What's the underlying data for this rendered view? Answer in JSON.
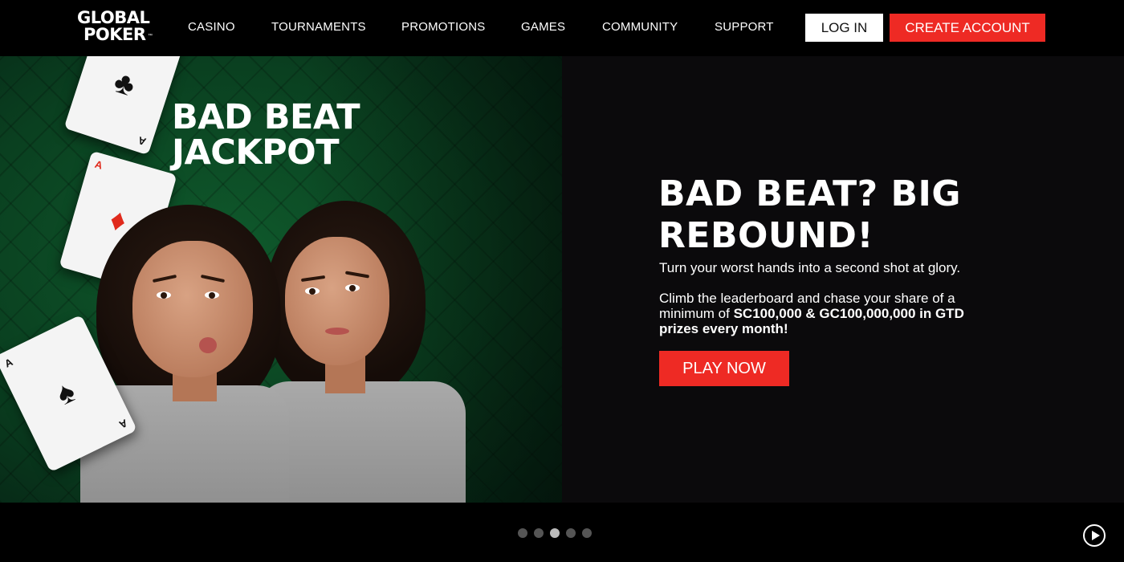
{
  "brand": {
    "logo_line1": "GLOBAL",
    "logo_line2": "POKER",
    "logo_mark": "™"
  },
  "nav": {
    "items": [
      "CASINO",
      "TOURNAMENTS",
      "PROMOTIONS",
      "GAMES",
      "COMMUNITY",
      "SUPPORT"
    ]
  },
  "auth": {
    "login_label": "LOG IN",
    "create_label": "CREATE ACCOUNT"
  },
  "hero": {
    "banner_title_line1": "BAD BEAT",
    "banner_title_line2": "JACKPOT",
    "headline_line1": "BAD BEAT? BIG",
    "headline_line2": "REBOUND!",
    "subheading": "Turn your worst hands into a second shot at glory.",
    "body_prefix": "Climb the leaderboard  and chase your share of a minimum of ",
    "body_bold": "SC100,000 & GC100,000,000 in GTD prizes every month!",
    "cta_label": "PLAY NOW",
    "cards": [
      {
        "suit": "♣",
        "rank": "A",
        "color": "black"
      },
      {
        "suit": "♦",
        "rank": "A",
        "color": "red"
      },
      {
        "suit": "♠",
        "rank": "A",
        "color": "black"
      }
    ]
  },
  "carousel": {
    "slide_count": 5,
    "active_index": 2,
    "autoplay_icon": "play-circle-icon"
  },
  "colors": {
    "accent_red": "#ee2a24",
    "background": "#000000",
    "felt_green": "#0a4020"
  }
}
